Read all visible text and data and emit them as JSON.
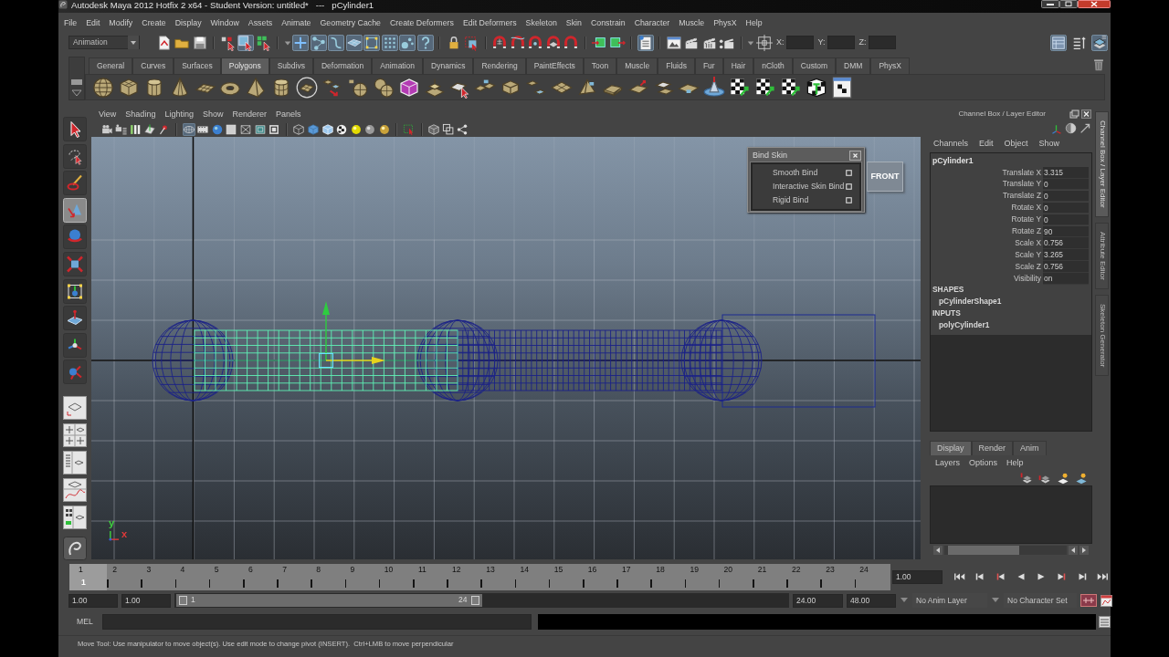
{
  "window": {
    "title": "Autodesk Maya 2012 Hotfix 2 x64 - Student Version: untitled*   ---   pCylinder1"
  },
  "menu_bar": [
    "File",
    "Edit",
    "Modify",
    "Create",
    "Display",
    "Window",
    "Assets",
    "Animate",
    "Geometry Cache",
    "Create Deformers",
    "Edit Deformers",
    "Skeleton",
    "Skin",
    "Constrain",
    "Character",
    "Muscle",
    "PhysX",
    "Help"
  ],
  "status_line": {
    "menu_set": "Animation",
    "buttons": [
      {
        "on": false
      },
      {
        "on": false
      },
      {
        "on": false
      },
      {
        "on": false
      },
      {
        "on": true
      },
      {
        "on": false
      },
      {
        "on": true
      },
      {
        "on": true
      },
      {
        "on": true
      },
      {
        "on": true
      },
      {
        "on": true
      },
      {
        "on": true
      },
      {
        "on": true
      },
      {
        "on": true
      },
      {
        "on": false
      },
      {
        "on": false
      },
      {
        "on": false
      },
      {
        "on": false
      },
      {
        "on": false
      },
      {
        "on": false
      },
      {
        "on": false
      },
      {
        "on": false
      },
      {
        "on": false
      },
      {
        "on": true
      },
      {
        "on": false
      },
      {
        "on": false
      },
      {
        "on": false
      },
      {
        "on": false
      },
      {
        "on": false
      },
      {
        "on": true
      },
      {
        "on": false
      },
      {
        "on": true
      }
    ],
    "coordinate_fields": [
      {
        "label": "X:"
      },
      {
        "label": "Y:"
      },
      {
        "label": "Z:"
      }
    ]
  },
  "shelf": {
    "tabs": [
      {
        "label": "General",
        "selected": false
      },
      {
        "label": "Curves",
        "selected": false
      },
      {
        "label": "Surfaces",
        "selected": false
      },
      {
        "label": "Polygons",
        "selected": true
      },
      {
        "label": "Subdivs",
        "selected": false
      },
      {
        "label": "Deformation",
        "selected": false
      },
      {
        "label": "Animation",
        "selected": false
      },
      {
        "label": "Dynamics",
        "selected": false
      },
      {
        "label": "Rendering",
        "selected": false
      },
      {
        "label": "PaintEffects",
        "selected": false
      },
      {
        "label": "Toon",
        "selected": false
      },
      {
        "label": "Muscle",
        "selected": false
      },
      {
        "label": "Fluids",
        "selected": false
      },
      {
        "label": "Fur",
        "selected": false
      },
      {
        "label": "Hair",
        "selected": false
      },
      {
        "label": "nCloth",
        "selected": false
      },
      {
        "label": "Custom",
        "selected": false
      },
      {
        "label": "DMM",
        "selected": false
      },
      {
        "label": "PhysX",
        "selected": false
      }
    ]
  },
  "toolbox": {
    "tools": [
      {
        "selected": false
      },
      {
        "selected": false
      },
      {
        "selected": false
      },
      {
        "selected": true
      },
      {
        "selected": false
      },
      {
        "selected": false
      },
      {
        "selected": false
      },
      {
        "selected": false
      },
      {
        "selected": false
      },
      {
        "selected": false
      }
    ]
  },
  "viewport": {
    "menus": [
      "View",
      "Shading",
      "Lighting",
      "Show",
      "Renderer",
      "Panels"
    ],
    "buttons": [
      {
        "on": false
      },
      {
        "on": false
      },
      {
        "on": false
      },
      {
        "on": false
      },
      {
        "on": false
      },
      {
        "on": true
      },
      {
        "on": false
      },
      {
        "on": false
      },
      {
        "on": false
      },
      {
        "on": false
      },
      {
        "on": false
      },
      {
        "on": false
      },
      {
        "on": false
      },
      {
        "on": false
      },
      {
        "on": false
      },
      {
        "on": false
      },
      {
        "on": false
      },
      {
        "on": false
      },
      {
        "on": false
      },
      {
        "on": false
      },
      {
        "on": false
      },
      {
        "on": false
      },
      {
        "on": false
      }
    ],
    "scene": [
      {
        "kind": "sphere",
        "selected": false
      },
      {
        "kind": "cylinder",
        "selected": true
      },
      {
        "kind": "sphere",
        "selected": false
      },
      {
        "kind": "cylinder",
        "selected": false
      },
      {
        "kind": "sphere",
        "selected": false
      }
    ],
    "view_cube_label": "FRONT",
    "axis_labels": [
      {
        "text": "y",
        "color": "#3fd43f"
      },
      {
        "text": "x",
        "color": "#e03a3a"
      }
    ]
  },
  "bind_skin_menu": {
    "title": "Bind Skin",
    "items": [
      "Smooth Bind",
      "Interactive Skin Bind",
      "Rigid Bind"
    ]
  },
  "channel_box": {
    "title": "Channel Box / Layer Editor",
    "menus": [
      "Channels",
      "Edit",
      "Object",
      "Show"
    ],
    "object": "pCylinder1",
    "channels": [
      {
        "name": "Translate X",
        "value": "3.315"
      },
      {
        "name": "Translate Y",
        "value": "0"
      },
      {
        "name": "Translate Z",
        "value": "0"
      },
      {
        "name": "Rotate X",
        "value": "0"
      },
      {
        "name": "Rotate Y",
        "value": "0"
      },
      {
        "name": "Rotate Z",
        "value": "90"
      },
      {
        "name": "Scale X",
        "value": "0.756"
      },
      {
        "name": "Scale Y",
        "value": "3.265"
      },
      {
        "name": "Scale Z",
        "value": "0.756"
      },
      {
        "name": "Visibility",
        "value": "on"
      }
    ],
    "sections": [
      {
        "heading": "SHAPES",
        "items": [
          "pCylinderShape1"
        ]
      },
      {
        "heading": "INPUTS",
        "items": [
          "polyCylinder1"
        ]
      }
    ]
  },
  "side_tabs": [
    {
      "label": "Channel Box / Layer Editor",
      "selected": true
    },
    {
      "label": "Attribute Editor",
      "selected": false
    },
    {
      "label": "Skeleton Generator",
      "selected": false
    }
  ],
  "layer_editor": {
    "tabs": [
      {
        "label": "Display",
        "selected": true
      },
      {
        "label": "Render",
        "selected": false
      },
      {
        "label": "Anim",
        "selected": false
      }
    ],
    "menus": [
      "Layers",
      "Options",
      "Help"
    ]
  },
  "time_slider": {
    "frames": [
      "1",
      "2",
      "3",
      "4",
      "5",
      "6",
      "7",
      "8",
      "9",
      "10",
      "11",
      "12",
      "13",
      "14",
      "15",
      "16",
      "17",
      "18",
      "19",
      "20",
      "21",
      "22",
      "23",
      "24"
    ],
    "current_frame": "1",
    "current_time": "1.00"
  },
  "range_slider": {
    "start_time": "1.00",
    "playback_start": "1.00",
    "range_start": "1",
    "range_end": "24",
    "level": 0.5,
    "playback_end": "24.00",
    "end_time": "48.00",
    "anim_layer": "No Anim Layer",
    "character_set": "No Character Set"
  },
  "command_line": {
    "label": "MEL"
  },
  "help_line": {
    "text": "Move Tool: Use manipulator to move object(s). Use edit mode to change pivot (INSERT).  Ctrl+LMB to move perpendicular"
  }
}
